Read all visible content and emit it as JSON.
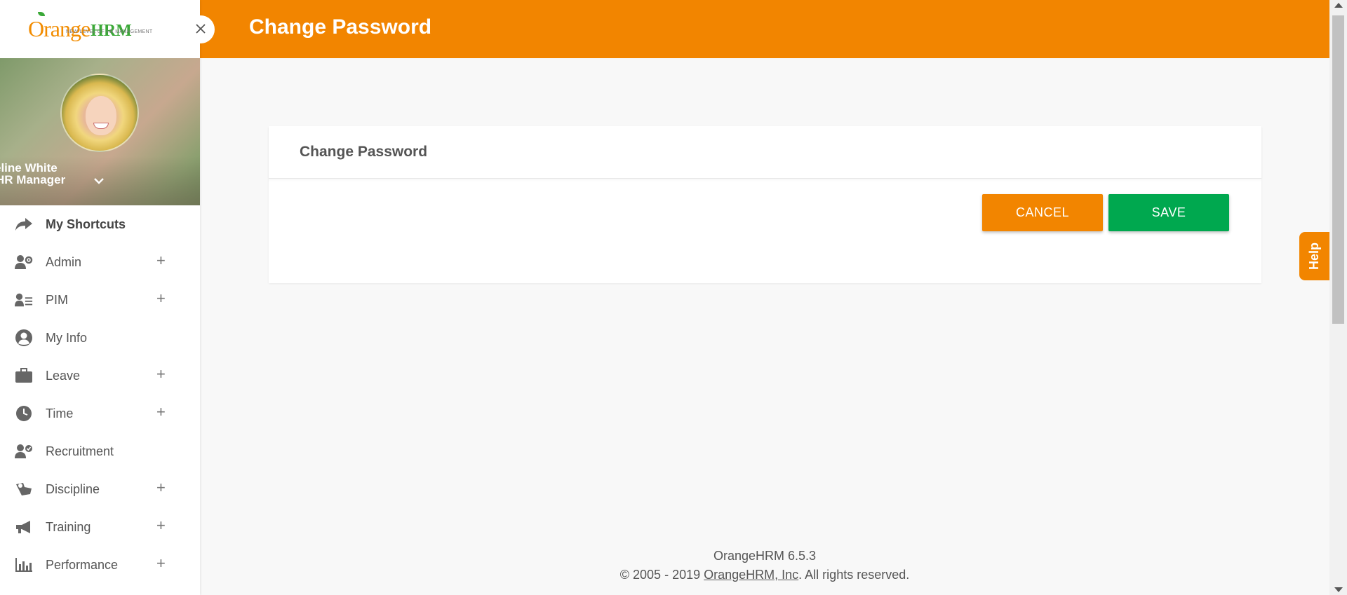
{
  "brand": {
    "logo_orange": "Orange",
    "logo_hrm": "HRM",
    "logo_tagline": "NEW LEVEL OF HR MANAGEMENT",
    "accent": "#f28500",
    "green": "#00a84f"
  },
  "sidebar": {
    "collapse_icon": "close-icon",
    "profile": {
      "name": "eline White",
      "role": "HR Manager"
    },
    "items": [
      {
        "label": "My Shortcuts",
        "icon": "share-arrow-icon",
        "expandable": false
      },
      {
        "label": "Admin",
        "icon": "user-gear-icon",
        "expandable": true
      },
      {
        "label": "PIM",
        "icon": "user-list-icon",
        "expandable": true
      },
      {
        "label": "My Info",
        "icon": "user-circle-icon",
        "expandable": false
      },
      {
        "label": "Leave",
        "icon": "briefcase-icon",
        "expandable": true
      },
      {
        "label": "Time",
        "icon": "clock-icon",
        "expandable": true
      },
      {
        "label": "Recruitment",
        "icon": "user-check-icon",
        "expandable": false
      },
      {
        "label": "Discipline",
        "icon": "discipline-icon",
        "expandable": true
      },
      {
        "label": "Training",
        "icon": "megaphone-icon",
        "expandable": true
      },
      {
        "label": "Performance",
        "icon": "bar-chart-icon",
        "expandable": true
      }
    ],
    "plus": "+"
  },
  "header": {
    "title": "Change Password"
  },
  "card": {
    "title": "Change Password",
    "cancel_label": "CANCEL",
    "save_label": "SAVE"
  },
  "help": {
    "label": "Help"
  },
  "footer": {
    "version": "OrangeHRM 6.5.3",
    "copyright_prefix": "© 2005 - 2019 ",
    "company_link": "OrangeHRM, Inc",
    "copyright_suffix": ". All rights reserved."
  }
}
